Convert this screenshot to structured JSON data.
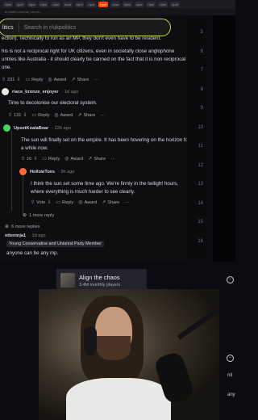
{
  "browser": {
    "tabs": [
      "r/pol",
      "r/pol",
      "r/pol",
      "r/pol",
      "r/pol",
      "r/pol",
      "r/pol",
      "r/pol",
      "r/pol",
      "r/pol",
      "r/pol",
      "r/pol",
      "r/pol",
      "r/pol",
      "r/pol"
    ],
    "url": "d.reddit.com/r/uk_comm..."
  },
  "search": {
    "chip": "litics",
    "placeholder": "Search in r/ukpolitics"
  },
  "comments": {
    "c1_line1": "ection). Technically to run as an MP, they don't even have to be resident.",
    "c1_line2": "his is not a reciprocal right for UK citizens, even in societally close anglophone",
    "c1_line3": "untries like Australia - it should clearly be canned on the fact that it is non reciprocal",
    "c1_line4": "one.",
    "c1_votes": "231",
    "reply": "Reply",
    "award": "Award",
    "share": "Share",
    "vote": "Vote",
    "c2_user": "riace_bronze_enjoyer",
    "c2_age": "· 1d ago",
    "c2_text": "Time to decolonise our electoral system.",
    "c2_votes": "131",
    "c3_user": "UpsetKoalaBear",
    "c3_age": "· 22h ago",
    "c3_line1": "The sun will finally set on the empire. It has been hovering on the horizon for",
    "c3_line2": "a while now.",
    "c3_votes": "16",
    "c4_user": "HollowToes",
    "c4_age": "· 9h ago",
    "c4_line1": "I think the sun set some time ago. We're firmly in the twilight hours,",
    "c4_line2": "where everything is much harder to see clearly.",
    "more_reply": "1 more reply",
    "more_replies": "6 more replies",
    "c5_user": "niteninja1",
    "c5_age": "· 1d ago",
    "c5_flair": "Young Conservative and Unionist Party Member",
    "c5_text": "anyone can be any mp."
  },
  "line_numbers": [
    "5",
    "6",
    "7",
    "8",
    "9",
    "10",
    "11",
    "12",
    "13",
    "14",
    "15",
    "16"
  ],
  "stream": {
    "game_title": "Align the chaos",
    "game_sub": "3.4M monthly players",
    "side_text_1": "nit",
    "side_text_2": "any"
  }
}
